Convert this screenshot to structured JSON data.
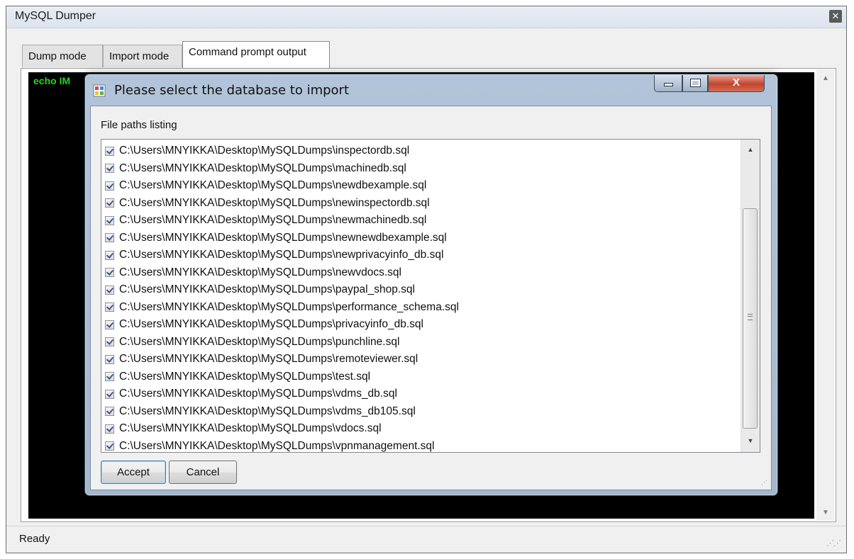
{
  "window": {
    "title": "MySQL Dumper",
    "close_glyph": "✕"
  },
  "tabs": [
    {
      "label": "Dump mode"
    },
    {
      "label": "Import mode"
    },
    {
      "label": "Command prompt output"
    }
  ],
  "console": {
    "text": "echo IM"
  },
  "status": {
    "text": "Ready"
  },
  "dialog": {
    "title": "Please select the database to import",
    "icon": "app-window-icon",
    "list_label": "File paths listing",
    "items": [
      {
        "path": "C:\\Users\\MNYIKKA\\Desktop\\MySQLDumps\\inspectordb.sql",
        "checked": true
      },
      {
        "path": "C:\\Users\\MNYIKKA\\Desktop\\MySQLDumps\\machinedb.sql",
        "checked": true
      },
      {
        "path": "C:\\Users\\MNYIKKA\\Desktop\\MySQLDumps\\newdbexample.sql",
        "checked": true
      },
      {
        "path": "C:\\Users\\MNYIKKA\\Desktop\\MySQLDumps\\newinspectordb.sql",
        "checked": true
      },
      {
        "path": "C:\\Users\\MNYIKKA\\Desktop\\MySQLDumps\\newmachinedb.sql",
        "checked": true
      },
      {
        "path": "C:\\Users\\MNYIKKA\\Desktop\\MySQLDumps\\newnewdbexample.sql",
        "checked": true
      },
      {
        "path": "C:\\Users\\MNYIKKA\\Desktop\\MySQLDumps\\newprivacyinfo_db.sql",
        "checked": true
      },
      {
        "path": "C:\\Users\\MNYIKKA\\Desktop\\MySQLDumps\\newvdocs.sql",
        "checked": true
      },
      {
        "path": "C:\\Users\\MNYIKKA\\Desktop\\MySQLDumps\\paypal_shop.sql",
        "checked": true
      },
      {
        "path": "C:\\Users\\MNYIKKA\\Desktop\\MySQLDumps\\performance_schema.sql",
        "checked": true
      },
      {
        "path": "C:\\Users\\MNYIKKA\\Desktop\\MySQLDumps\\privacyinfo_db.sql",
        "checked": true
      },
      {
        "path": "C:\\Users\\MNYIKKA\\Desktop\\MySQLDumps\\punchline.sql",
        "checked": true
      },
      {
        "path": "C:\\Users\\MNYIKKA\\Desktop\\MySQLDumps\\remoteviewer.sql",
        "checked": true
      },
      {
        "path": "C:\\Users\\MNYIKKA\\Desktop\\MySQLDumps\\test.sql",
        "checked": true
      },
      {
        "path": "C:\\Users\\MNYIKKA\\Desktop\\MySQLDumps\\vdms_db.sql",
        "checked": true
      },
      {
        "path": "C:\\Users\\MNYIKKA\\Desktop\\MySQLDumps\\vdms_db105.sql",
        "checked": true
      },
      {
        "path": "C:\\Users\\MNYIKKA\\Desktop\\MySQLDumps\\vdocs.sql",
        "checked": true
      },
      {
        "path": "C:\\Users\\MNYIKKA\\Desktop\\MySQLDumps\\vpnmanagement.sql",
        "checked": true
      }
    ],
    "accept_label": "Accept",
    "cancel_label": "Cancel",
    "close_glyph": "X"
  },
  "colors": {
    "console_text": "#25d51e",
    "console_bg": "#000000",
    "close_button": "#c2442c"
  }
}
